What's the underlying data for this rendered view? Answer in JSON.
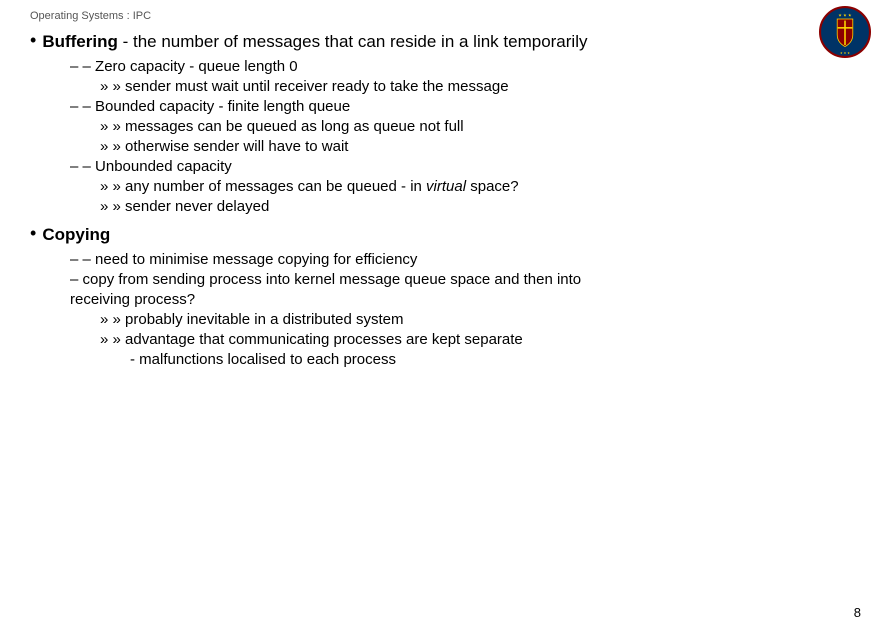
{
  "header": {
    "title": "Operating Systems : IPC"
  },
  "page_number": "8",
  "buffering_section": {
    "bullet": "Buffering",
    "description": "- the number of messages that can reside in a link temporarily",
    "zero_capacity": {
      "label": "– Zero capacity - queue length 0",
      "sub": "» sender must wait until receiver ready to take the message"
    },
    "bounded_capacity": {
      "label": "– Bounded capacity - finite length queue",
      "sub1": "» messages can be queued as long as queue not full",
      "sub2": "» otherwise sender will have to wait"
    },
    "unbounded_capacity": {
      "label": "– Unbounded capacity",
      "sub1_prefix": "» any number of messages can be queued - in ",
      "sub1_italic": "virtual",
      "sub1_suffix": " space?",
      "sub2": "» sender never delayed"
    }
  },
  "copying_section": {
    "bullet": "Copying",
    "line1": "– need to minimise message copying for efficiency",
    "line2": "– copy from sending process into kernel message queue space and then into",
    "line2b": "receiving process?",
    "sub1": "» probably inevitable in a distributed system",
    "sub2": "» advantage that communicating processes are kept separate",
    "sub3": "-  malfunctions localised to each process"
  }
}
